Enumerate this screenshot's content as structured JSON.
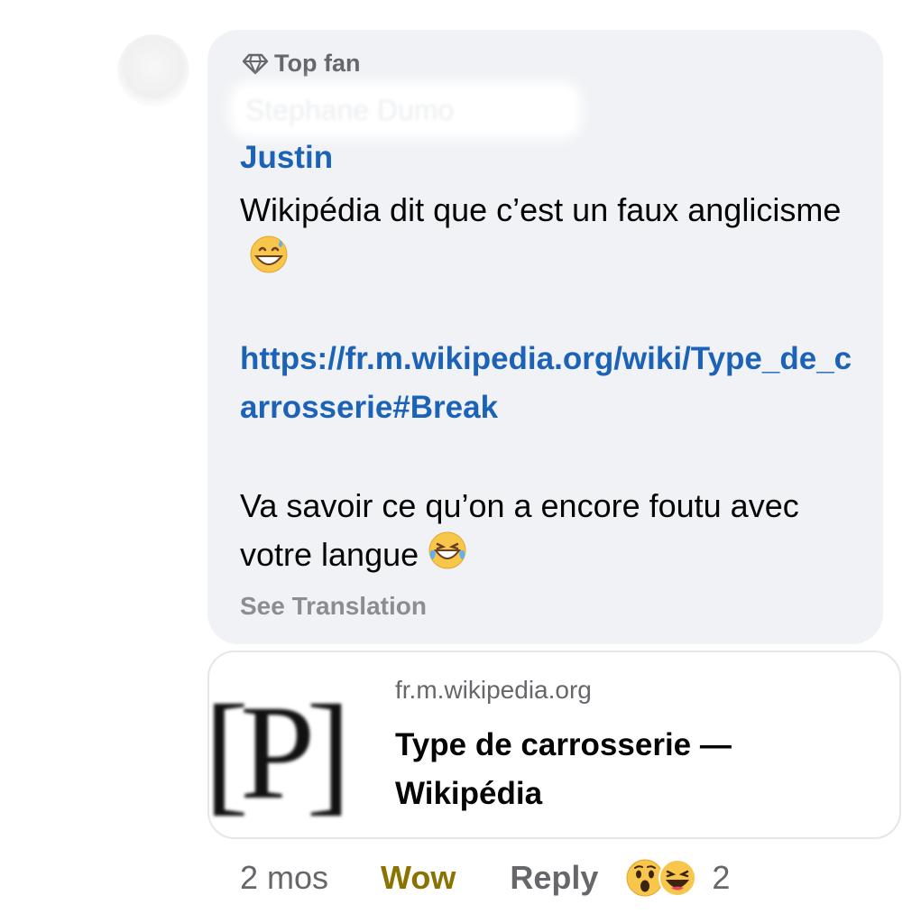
{
  "comment": {
    "badge_label": "Top fan",
    "blurred_name": "Stephane Dumo",
    "author": "Justin",
    "text_line1": "Wikipédia dit que c’est un faux anglicisme",
    "link_text": "https://fr.m.wikipedia.org/wiki/Type_de_carrosserie#Break",
    "text_line2": "Va savoir ce qu’on a encore foutu avec votre langue",
    "see_translation": "See Translation",
    "icons": {
      "badge": "diamond-icon",
      "emoji1": "grinning-sweat-emoji",
      "emoji2": "tears-of-joy-emoji"
    }
  },
  "link_preview": {
    "domain": "fr.m.wikipedia.org",
    "title": "Type de carrosserie — Wikipédia",
    "thumbnail_glyph": "[P]"
  },
  "footer": {
    "time": "2 mos",
    "reaction_label": "Wow",
    "reply_label": "Reply",
    "reaction_count": "2",
    "reaction_icons": [
      "wow-emoji",
      "haha-emoji"
    ]
  },
  "colors": {
    "link": "#1c63b7",
    "wow": "#8a7300",
    "bubble": "#f0f2f5",
    "muted": "#65676b"
  }
}
